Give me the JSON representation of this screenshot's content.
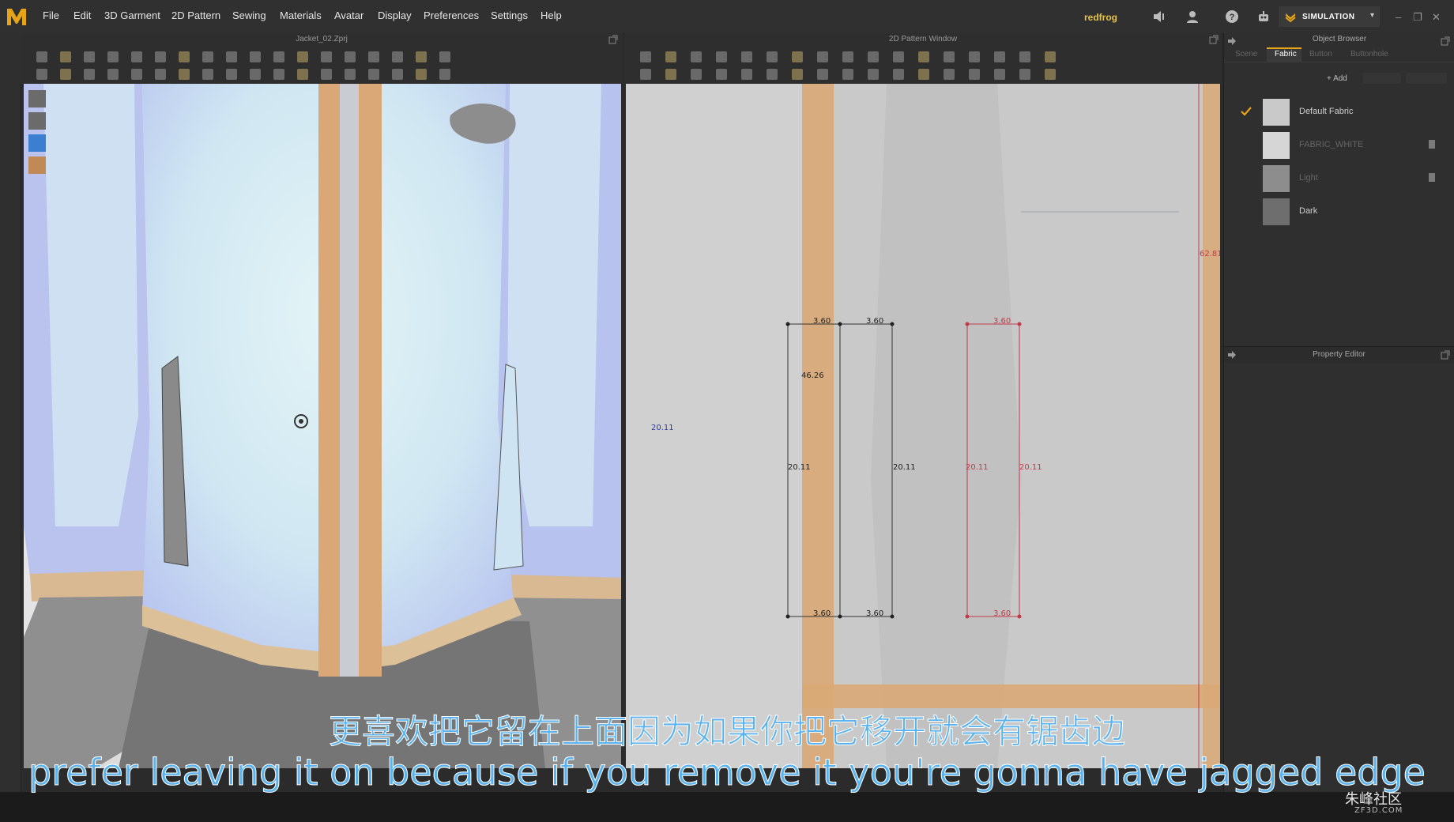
{
  "app": {
    "menu": [
      "File",
      "Edit",
      "3D Garment",
      "2D Pattern",
      "Sewing",
      "Materials",
      "Avatar",
      "Display",
      "Preferences",
      "Settings",
      "Help"
    ],
    "user": "redfrog",
    "simulation_label": "SIMULATION",
    "accent_color": "#e5a516"
  },
  "panel3d": {
    "title": "Jacket_02.Zprj"
  },
  "panel2d": {
    "title": "2D Pattern Window",
    "labels": {
      "left_dim": "20.11",
      "top_a": "3.60",
      "top_b": "3.60",
      "top_red": "3.60",
      "height": "46.26",
      "mid_left": "20.11",
      "mid_right": "20.11",
      "red_left": "20.11",
      "red_right": "20.11",
      "bottom_a": "3.60",
      "bottom_b": "3.60",
      "bottom_red": "3.60",
      "edge_red": "62.81"
    }
  },
  "object_browser": {
    "title": "Object Browser",
    "tabs": [
      "Scene",
      "Fabric",
      "Button",
      "Buttonhole"
    ],
    "active_tab": "Fabric",
    "add_label": "+ Add",
    "fabrics": [
      {
        "name": "Default Fabric",
        "checked": true
      },
      {
        "name": "FABRIC_WHITE",
        "checked": false
      },
      {
        "name": "Light",
        "checked": false
      },
      {
        "name": "Dark",
        "checked": false
      }
    ]
  },
  "property_editor": {
    "title": "Property Editor"
  },
  "subtitles": {
    "chinese": "更喜欢把它留在上面因为如果你把它移开就会有锯齿边",
    "english": "prefer leaving it on because if you remove it you're gonna have jagged edge"
  },
  "watermark": {
    "main": "朱峰社区",
    "sub": "ZF3D.COM"
  }
}
